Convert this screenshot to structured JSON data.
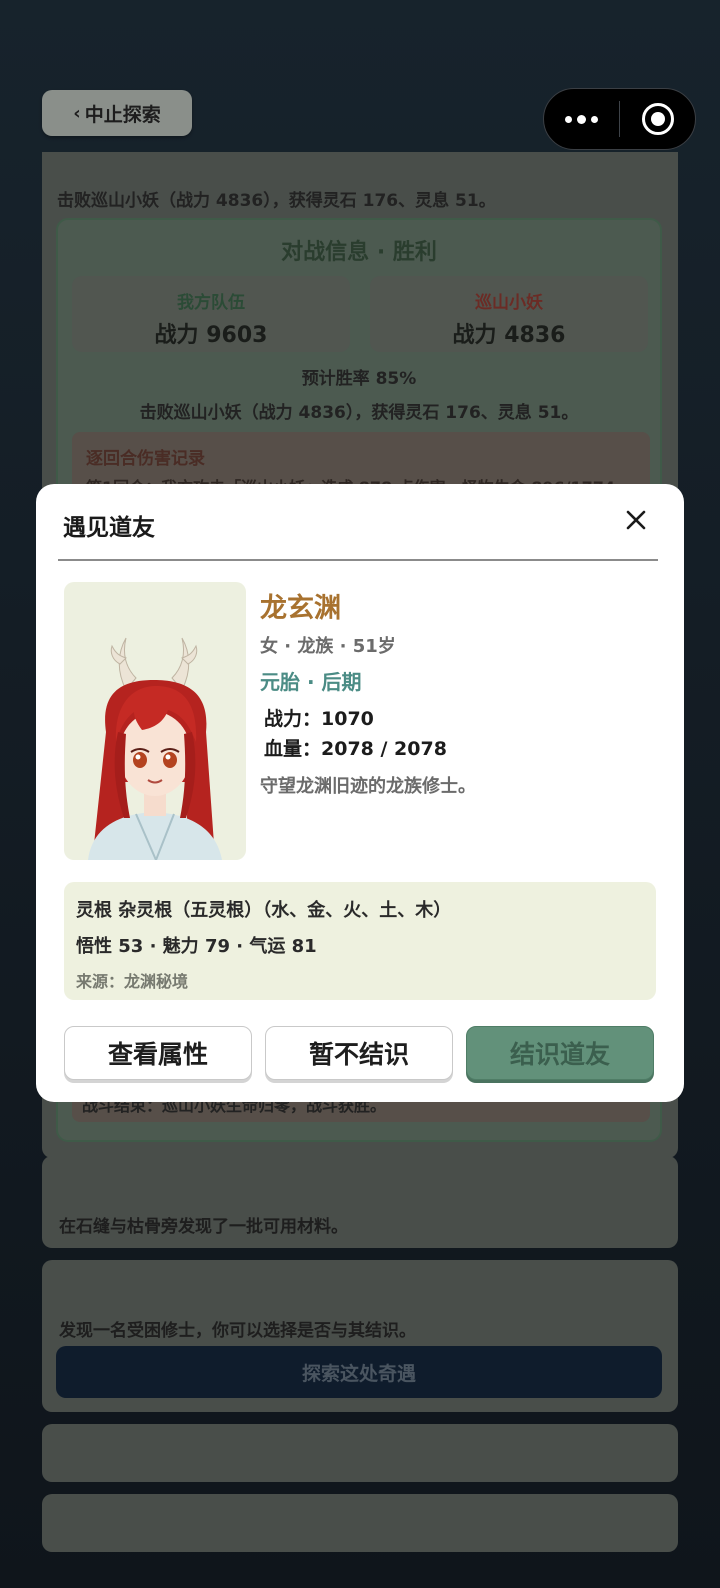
{
  "nav": {
    "back_label": "中止探索"
  },
  "log": {
    "summary": "击败巡山小妖（战力 4836），获得灵石 176、灵息 51。",
    "battle": {
      "title": "对战信息 · 胜利",
      "our_team": {
        "label": "我方队伍",
        "power": "战力 9603"
      },
      "enemy_team": {
        "label": "巡山小妖",
        "power": "战力 4836"
      },
      "win_rate": "预计胜率 85%",
      "result": "击败巡山小妖（战力 4836），获得灵石 176、灵息 51。",
      "damage_title": "逐回合伤害记录",
      "damage_line": "第1回合：我方攻击「巡山小妖」造成 878 点伤害，怪物生命 896/1774",
      "end_text": "战斗结束：巡山小妖生命归零，战斗获胜。"
    }
  },
  "events": [
    {
      "text": "在石缝与枯骨旁发现了一批可用材料。"
    },
    {
      "text": "发现一名受困修士，你可以选择是否与其结识。",
      "button": "探索这处奇遇"
    }
  ],
  "modal": {
    "title": "遇见道友",
    "name": "龙玄渊",
    "meta": "女 · 龙族 · 51岁",
    "realm": "元胎 · 后期",
    "power": "战力：1070",
    "hp": "血量：2078 / 2078",
    "description": "守望龙渊旧迹的龙族修士。",
    "spirit_root": "灵根 杂灵根（五灵根）（水、金、火、土、木）",
    "attributes": "悟性 53 · 魅力 79 · 气运 81",
    "source": "来源：龙渊秘境",
    "buttons": {
      "view": "查看属性",
      "decline": "暂不结识",
      "befriend": "结识道友"
    }
  }
}
